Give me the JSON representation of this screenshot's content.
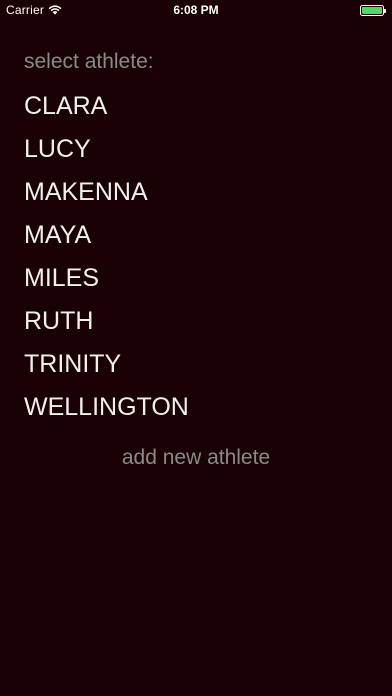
{
  "status_bar": {
    "carrier": "Carrier",
    "time": "6:08 PM",
    "battery_color": "#4cd964",
    "wifi_icon": "wifi-icon",
    "battery_icon": "battery-icon"
  },
  "screen": {
    "background_color": "#1a0103",
    "prompt": "select athlete:",
    "athletes": [
      {
        "name": "CLARA"
      },
      {
        "name": "LUCY"
      },
      {
        "name": "MAKENNA"
      },
      {
        "name": "MAYA"
      },
      {
        "name": "MILES"
      },
      {
        "name": "RUTH"
      },
      {
        "name": "TRINITY"
      },
      {
        "name": "WELLINGTON"
      }
    ],
    "add_button_label": "add new athlete"
  }
}
